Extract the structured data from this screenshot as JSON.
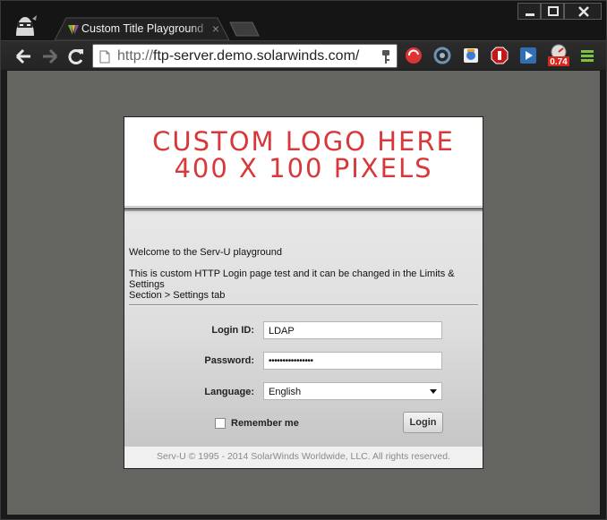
{
  "browser": {
    "tab": {
      "title": "Custom Title Playground | Serv-U",
      "close": "×"
    },
    "omnibox": {
      "protocol": "http://",
      "host": "ftp-server.demo.solarwinds.com/"
    },
    "badge": "0.74",
    "icons": [
      "ninja-avatar-icon",
      "back-icon",
      "forward-icon",
      "reload-icon",
      "page-icon",
      "key-icon",
      "lastpass-icon",
      "sync-icon",
      "extension-icon",
      "adblock-icon",
      "play-icon",
      "speedometer-icon",
      "menu-icon"
    ],
    "colors": {
      "frame": "#151515",
      "viewport": "#646461"
    }
  },
  "page": {
    "logo": {
      "line1": "CUSTOM LOGO HERE",
      "line2": "400 X 100 PIXELS",
      "color": "#d8383a"
    },
    "welcome": "Welcome to the Serv-U playground",
    "info_line1": "This is custom HTTP Login page test and it can be changed in the Limits &",
    "info_line2": "Settings",
    "info_line3": "Section > Settings tab",
    "form": {
      "login_label": "Login ID:",
      "login_value": "LDAP",
      "password_label": "Password:",
      "password_value": "••••••••••••••••",
      "language_label": "Language:",
      "language_value": "English",
      "remember_label": "Remember me",
      "login_button": "Login"
    },
    "footer": "Serv-U © 1995 - 2014 SolarWinds Worldwide, LLC. All rights reserved."
  }
}
